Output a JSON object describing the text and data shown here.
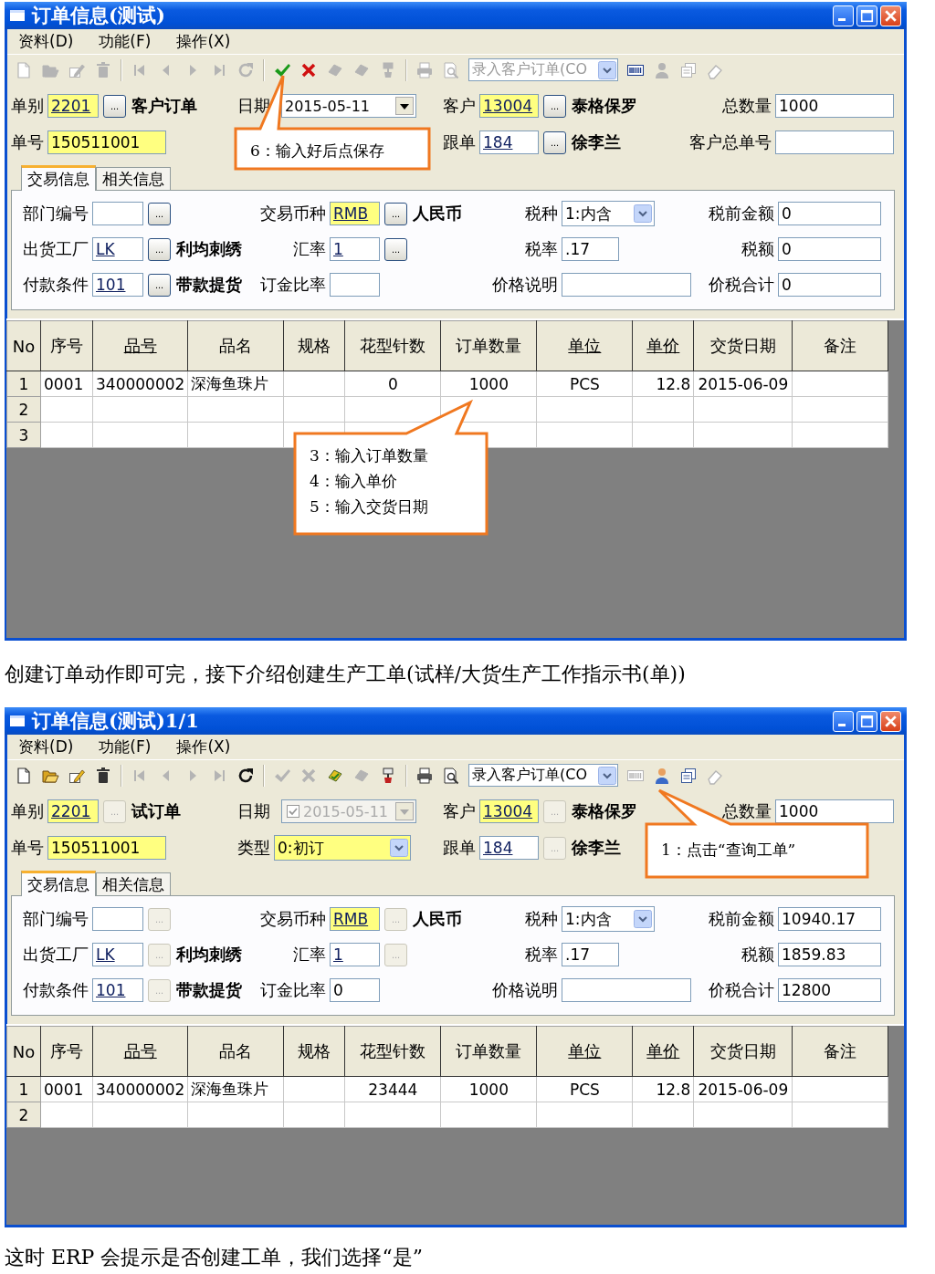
{
  "windows": [
    {
      "title": "订单信息(测试)",
      "menu": [
        "资料(D)",
        "功能(F)",
        "操作(X)"
      ],
      "toolbar": [
        {
          "kind": "new",
          "disabled": true
        },
        {
          "kind": "open",
          "disabled": true
        },
        {
          "kind": "edit",
          "disabled": true
        },
        {
          "kind": "delete",
          "disabled": true
        },
        {
          "kind": "separator"
        },
        {
          "kind": "first",
          "disabled": true
        },
        {
          "kind": "prev",
          "disabled": true
        },
        {
          "kind": "next",
          "disabled": true
        },
        {
          "kind": "last",
          "disabled": true
        },
        {
          "kind": "refresh",
          "disabled": true
        },
        {
          "kind": "separator"
        },
        {
          "kind": "save",
          "disabled": false
        },
        {
          "kind": "cancel",
          "disabled": false
        },
        {
          "kind": "approve",
          "disabled": true
        },
        {
          "kind": "unapprove",
          "disabled": true
        },
        {
          "kind": "brush",
          "disabled": true
        },
        {
          "kind": "separator"
        },
        {
          "kind": "print",
          "disabled": true
        },
        {
          "kind": "preview",
          "disabled": true
        },
        {
          "kind": "combo",
          "text": "录入客户订单(CO",
          "disabled": true
        },
        {
          "kind": "barcode",
          "disabled": false
        },
        {
          "kind": "person",
          "disabled": true
        },
        {
          "kind": "copy",
          "disabled": true
        },
        {
          "kind": "eraser",
          "disabled": true
        }
      ],
      "header": [
        {
          "first": [
            {
              "kind": "label",
              "text": "单别"
            },
            {
              "kind": "field",
              "text": "2201",
              "highlight": true,
              "link": true
            },
            {
              "kind": "lookup",
              "text": "...",
              "disabled": false
            },
            {
              "kind": "name",
              "text": "客户订单"
            }
          ],
          "second": [
            {
              "kind": "label",
              "text": "日期"
            },
            {
              "kind": "date",
              "text": "2015-05-11",
              "disabled": false
            }
          ],
          "third": [
            {
              "kind": "label",
              "text": "客户"
            },
            {
              "kind": "field",
              "text": "13004",
              "highlight": true,
              "link": true
            },
            {
              "kind": "lookup",
              "text": "...",
              "disabled": false
            },
            {
              "kind": "name",
              "text": "泰格保罗"
            }
          ],
          "fourth": [
            {
              "kind": "label",
              "text": "总数量"
            },
            {
              "kind": "field",
              "text": "1000",
              "highlight": false,
              "link": false
            }
          ]
        },
        {
          "first": [
            {
              "kind": "label",
              "text": "单号"
            },
            {
              "kind": "field",
              "text": "150511001",
              "highlight": true,
              "link": false
            }
          ],
          "third": [
            {
              "kind": "label",
              "text": "跟单"
            },
            {
              "kind": "field",
              "text": "184",
              "highlight": false,
              "link": true
            },
            {
              "kind": "lookup",
              "text": "...",
              "disabled": false
            },
            {
              "kind": "name",
              "text": "徐李兰"
            }
          ],
          "fourth": [
            {
              "kind": "label",
              "text": "客户总单号"
            },
            {
              "kind": "field",
              "highlight": false
            }
          ]
        }
      ],
      "tabs": [
        {
          "label": "交易信息",
          "selected": true
        },
        {
          "label": "相关信息",
          "selected": false
        }
      ],
      "form": [
        [
          [
            {
              "kind": "label",
              "text": "部门编号"
            },
            {
              "kind": "field",
              "highlight": false
            },
            {
              "kind": "lookup",
              "text": "...",
              "disabled": false
            }
          ],
          [
            {
              "kind": "label",
              "text": "交易币种"
            },
            {
              "kind": "field",
              "text": "RMB",
              "highlight": true,
              "link": true
            },
            {
              "kind": "lookup",
              "text": "...",
              "disabled": false
            },
            {
              "kind": "name",
              "text": "人民币"
            }
          ],
          [
            {
              "kind": "label",
              "text": "税种"
            },
            {
              "kind": "combo",
              "text": "1:内含",
              "highlight": false
            }
          ],
          [
            {
              "kind": "label",
              "text": "税前金额"
            },
            {
              "kind": "field",
              "text": "0",
              "highlight": false,
              "link": false
            }
          ]
        ],
        [
          [
            {
              "kind": "label",
              "text": "出货工厂"
            },
            {
              "kind": "field",
              "text": "LK",
              "highlight": false,
              "link": true
            },
            {
              "kind": "lookup",
              "text": "...",
              "disabled": false
            },
            {
              "kind": "name",
              "text": "利均刺绣"
            }
          ],
          [
            {
              "kind": "label",
              "text": "汇率"
            },
            {
              "kind": "field",
              "text": "1",
              "highlight": false,
              "link": true
            },
            {
              "kind": "lookup",
              "text": "...",
              "disabled": false
            }
          ],
          [
            {
              "kind": "label",
              "text": "税率"
            },
            {
              "kind": "field",
              "text": ".17",
              "highlight": false,
              "link": false
            }
          ],
          [
            {
              "kind": "label",
              "text": "税额"
            },
            {
              "kind": "field",
              "text": "0",
              "highlight": false,
              "link": false
            }
          ]
        ],
        [
          [
            {
              "kind": "label",
              "text": "付款条件"
            },
            {
              "kind": "field",
              "text": "101",
              "highlight": false,
              "link": true
            },
            {
              "kind": "lookup",
              "text": "...",
              "disabled": false
            },
            {
              "kind": "name",
              "text": "带款提货"
            }
          ],
          [
            {
              "kind": "label",
              "text": "订金比率"
            },
            {
              "kind": "field",
              "highlight": false
            }
          ],
          [
            {
              "kind": "label",
              "text": "价格说明"
            },
            {
              "kind": "field",
              "highlight": false
            }
          ],
          [
            {
              "kind": "label",
              "text": "价税合计"
            },
            {
              "kind": "field",
              "text": "0",
              "highlight": false,
              "link": false
            }
          ]
        ]
      ],
      "table": {
        "columns": [
          {
            "label": "No",
            "link": false
          },
          {
            "label": "序号",
            "link": false
          },
          {
            "label": "品号",
            "link": true
          },
          {
            "label": "品名",
            "link": false
          },
          {
            "label": "规格",
            "link": false
          },
          {
            "label": "花型针数",
            "link": false
          },
          {
            "label": "订单数量",
            "link": false
          },
          {
            "label": "单位",
            "link": true
          },
          {
            "label": "单价",
            "link": true
          },
          {
            "label": "交货日期",
            "link": false
          },
          {
            "label": "备注",
            "link": false
          }
        ],
        "rows": [
          {
            "no": "1",
            "cells": [
              "0001",
              "340000002",
              "深海鱼珠片",
              null,
              "0",
              "1000",
              "PCS",
              "12.8",
              "2015-06-09",
              null
            ]
          },
          {
            "no": "2"
          },
          {
            "no": "3"
          }
        ]
      },
      "callouts": [
        {
          "lines": [
            "6：输入好后点保存"
          ]
        },
        {
          "lines": [
            "3：输入订单数量",
            "4：输入单价",
            "5：输入交货日期"
          ]
        }
      ]
    },
    {
      "title": "订单信息(测试)1/1",
      "menu": [
        "资料(D)",
        "功能(F)",
        "操作(X)"
      ],
      "toolbar": [
        {
          "kind": "new",
          "disabled": false
        },
        {
          "kind": "open",
          "disabled": false
        },
        {
          "kind": "edit",
          "disabled": false
        },
        {
          "kind": "delete",
          "disabled": false
        },
        {
          "kind": "separator"
        },
        {
          "kind": "first",
          "disabled": true
        },
        {
          "kind": "prev",
          "disabled": true
        },
        {
          "kind": "next",
          "disabled": true
        },
        {
          "kind": "last",
          "disabled": true
        },
        {
          "kind": "refresh",
          "disabled": false
        },
        {
          "kind": "separator"
        },
        {
          "kind": "save",
          "disabled": true
        },
        {
          "kind": "cancel",
          "disabled": true
        },
        {
          "kind": "approve",
          "disabled": false
        },
        {
          "kind": "unapprove",
          "disabled": true
        },
        {
          "kind": "brush",
          "disabled": false
        },
        {
          "kind": "separator"
        },
        {
          "kind": "print",
          "disabled": false
        },
        {
          "kind": "preview",
          "disabled": false
        },
        {
          "kind": "combo",
          "text": "录入客户订单(CO",
          "disabled": false
        },
        {
          "kind": "barcode",
          "disabled": true
        },
        {
          "kind": "person",
          "disabled": false
        },
        {
          "kind": "copy",
          "disabled": false
        },
        {
          "kind": "eraser",
          "disabled": true
        }
      ],
      "header": [
        {
          "first": [
            {
              "kind": "label",
              "text": "单别"
            },
            {
              "kind": "field",
              "text": "2201",
              "highlight": true,
              "link": true
            },
            {
              "kind": "lookup",
              "text": "...",
              "disabled": true
            },
            {
              "kind": "name",
              "text": "试订单"
            }
          ],
          "second": [
            {
              "kind": "label",
              "text": "日期"
            },
            {
              "kind": "date",
              "text": "2015-05-11",
              "checked": true,
              "disabled": true
            }
          ],
          "third": [
            {
              "kind": "label",
              "text": "客户"
            },
            {
              "kind": "field",
              "text": "13004",
              "highlight": true,
              "link": true
            },
            {
              "kind": "lookup",
              "text": "...",
              "disabled": true
            },
            {
              "kind": "name",
              "text": "泰格保罗"
            }
          ],
          "fourth": [
            {
              "kind": "label",
              "text": "总数量"
            },
            {
              "kind": "field",
              "text": "1000",
              "highlight": false,
              "link": false
            }
          ]
        },
        {
          "first": [
            {
              "kind": "label",
              "text": "单号"
            },
            {
              "kind": "field",
              "text": "150511001",
              "highlight": true,
              "link": false
            }
          ],
          "second": [
            {
              "kind": "label",
              "text": "类型"
            },
            {
              "kind": "combo",
              "text": "0:初订",
              "highlight": true
            }
          ],
          "third": [
            {
              "kind": "label",
              "text": "跟单"
            },
            {
              "kind": "field",
              "text": "184",
              "highlight": false,
              "link": true
            },
            {
              "kind": "lookup",
              "text": "...",
              "disabled": true
            },
            {
              "kind": "name",
              "text": "徐李兰"
            }
          ]
        }
      ],
      "tabs": [
        {
          "label": "交易信息",
          "selected": true
        },
        {
          "label": "相关信息",
          "selected": false
        }
      ],
      "form": [
        [
          [
            {
              "kind": "label",
              "text": "部门编号"
            },
            {
              "kind": "field",
              "highlight": false
            },
            {
              "kind": "lookup",
              "text": "...",
              "disabled": true
            }
          ],
          [
            {
              "kind": "label",
              "text": "交易币种"
            },
            {
              "kind": "field",
              "text": "RMB",
              "highlight": true,
              "link": true
            },
            {
              "kind": "lookup",
              "text": "...",
              "disabled": true
            },
            {
              "kind": "name",
              "text": "人民币"
            }
          ],
          [
            {
              "kind": "label",
              "text": "税种"
            },
            {
              "kind": "combo",
              "text": "1:内含",
              "highlight": false
            }
          ],
          [
            {
              "kind": "label",
              "text": "税前金额"
            },
            {
              "kind": "field",
              "text": "10940.17",
              "highlight": false,
              "link": false
            }
          ]
        ],
        [
          [
            {
              "kind": "label",
              "text": "出货工厂"
            },
            {
              "kind": "field",
              "text": "LK",
              "highlight": false,
              "link": true
            },
            {
              "kind": "lookup",
              "text": "...",
              "disabled": true
            },
            {
              "kind": "name",
              "text": "利均刺绣"
            }
          ],
          [
            {
              "kind": "label",
              "text": "汇率"
            },
            {
              "kind": "field",
              "text": "1",
              "highlight": false,
              "link": true
            },
            {
              "kind": "lookup",
              "text": "...",
              "disabled": true
            }
          ],
          [
            {
              "kind": "label",
              "text": "税率"
            },
            {
              "kind": "field",
              "text": ".17",
              "highlight": false,
              "link": false
            }
          ],
          [
            {
              "kind": "label",
              "text": "税额"
            },
            {
              "kind": "field",
              "text": "1859.83",
              "highlight": false,
              "link": false
            }
          ]
        ],
        [
          [
            {
              "kind": "label",
              "text": "付款条件"
            },
            {
              "kind": "field",
              "text": "101",
              "highlight": false,
              "link": true
            },
            {
              "kind": "lookup",
              "text": "...",
              "disabled": true
            },
            {
              "kind": "name",
              "text": "带款提货"
            }
          ],
          [
            {
              "kind": "label",
              "text": "订金比率"
            },
            {
              "kind": "field",
              "text": "0",
              "highlight": false,
              "link": false
            }
          ],
          [
            {
              "kind": "label",
              "text": "价格说明"
            },
            {
              "kind": "field",
              "highlight": false
            }
          ],
          [
            {
              "kind": "label",
              "text": "价税合计"
            },
            {
              "kind": "field",
              "text": "12800",
              "highlight": false,
              "link": false
            }
          ]
        ]
      ],
      "table": {
        "columns": [
          {
            "label": "No",
            "link": false
          },
          {
            "label": "序号",
            "link": false
          },
          {
            "label": "品号",
            "link": true
          },
          {
            "label": "品名",
            "link": false
          },
          {
            "label": "规格",
            "link": false
          },
          {
            "label": "花型针数",
            "link": false
          },
          {
            "label": "订单数量",
            "link": false
          },
          {
            "label": "单位",
            "link": true
          },
          {
            "label": "单价",
            "link": true
          },
          {
            "label": "交货日期",
            "link": false
          },
          {
            "label": "备注",
            "link": false
          }
        ],
        "rows": [
          {
            "no": "1",
            "cells": [
              "0001",
              "340000002",
              "深海鱼珠片",
              null,
              "23444",
              "1000",
              "PCS",
              "12.8",
              "2015-06-09",
              null
            ]
          },
          {
            "no": "2"
          }
        ]
      },
      "callouts": [
        {
          "lines": [
            "1：点击“查询工单”"
          ]
        }
      ]
    }
  ],
  "captions": [
    "创建订单动作即可完，接下介绍创建生产工单(试样/大货生产工作指示书(单))",
    "这时 ERP 会提示是否创建工单，我们选择“是”"
  ]
}
